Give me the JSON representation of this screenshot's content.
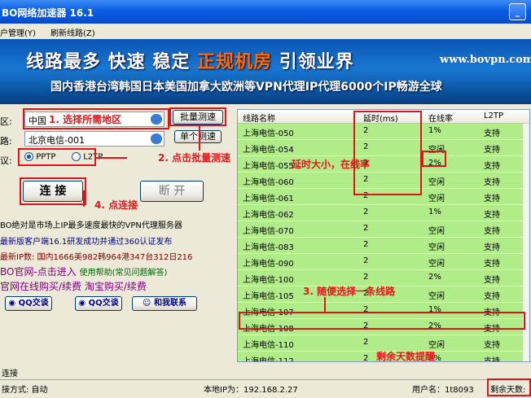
{
  "window": {
    "title": "BO网络加速器 16.1"
  },
  "menu": {
    "items": [
      "户管理(Y)",
      "刷新线路(Z)"
    ]
  },
  "banner": {
    "line1_a": "线路最多 快速 稳定",
    "line1_b": "正规机房",
    "line1_c": "引领业界",
    "url": "www.bovpn.com",
    "line2": "国内香港台湾韩国日本美国加拿大欧洲等VPN代理IP代理6000个IP畅游全球"
  },
  "form": {
    "region_label": "区:",
    "region_value": "中国",
    "line_label": "路:",
    "line_value": "北京电信-001",
    "protocol_label": "议:",
    "protocol_options": [
      "PPTP",
      "L2TP"
    ],
    "batch_test": "批量测速",
    "single_test": "单个测速",
    "connect": "连 接",
    "disconnect": "断 开"
  },
  "annotations": {
    "step1": "1. 选择所需地区",
    "step2": "2. 点击批量测速",
    "step3": "3. 随便选择一条线路",
    "step4": "4. 点连接",
    "latency_hint": "延时大小，在线率",
    "days_hint": "剩余天数提醒"
  },
  "news": [
    "BO绝对是市场上IP最多速度最快的VPN代理服务器",
    "最新版客户端16.1研发成功并通过360认证发布",
    "最新IP数: 国内1666美982韩964港347台312日216"
  ],
  "links": {
    "official": "BO官网-点击进入",
    "help": "使用帮助(常见问题解答)",
    "buy": "官网在线购买/续费 淘宝购买/续费",
    "qq1": "QQ交谈",
    "qq2": "QQ交谈",
    "contact": "和我联系"
  },
  "table": {
    "columns": [
      "线路名称",
      "延时(ms)",
      "在线率",
      "L2TP"
    ],
    "rows": [
      [
        "上海电信-050",
        "2",
        "1%",
        "支持"
      ],
      [
        "上海电信-054",
        "2",
        "空闲",
        "支持"
      ],
      [
        "上海电信-055",
        "2",
        "2%",
        "支持"
      ],
      [
        "上海电信-060",
        "2",
        "空闲",
        "支持"
      ],
      [
        "上海电信-061",
        "2",
        "空闲",
        "支持"
      ],
      [
        "上海电信-062",
        "2",
        "1%",
        "支持"
      ],
      [
        "上海电信-070",
        "2",
        "空闲",
        "支持"
      ],
      [
        "上海电信-083",
        "2",
        "空闲",
        "支持"
      ],
      [
        "上海电信-090",
        "2",
        "空闲",
        "支持"
      ],
      [
        "上海电信-100",
        "2",
        "2%",
        "支持"
      ],
      [
        "上海电信-105",
        "2",
        "空闲",
        "支持"
      ],
      [
        "上海电信-107",
        "2",
        "1%",
        "支持"
      ],
      [
        "上海电信-108",
        "2",
        "2%",
        "支持"
      ],
      [
        "上海电信-110",
        "2",
        "空闲",
        "支持"
      ],
      [
        "上海电信-112",
        "2",
        "2%",
        "支持"
      ]
    ]
  },
  "status": {
    "state": "连接",
    "mode_label": "接方式: 自动",
    "ip_label": "本地IP为：192.168.2.27",
    "user_label": "用户名：1t8093",
    "days_label": "剩余天数:"
  }
}
